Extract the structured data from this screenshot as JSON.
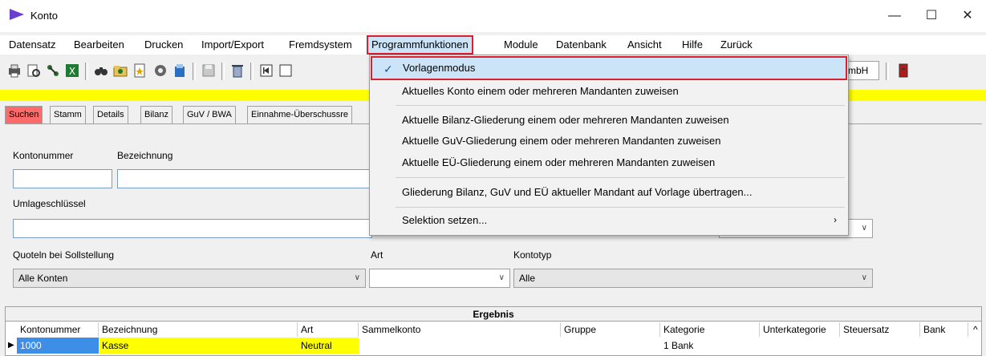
{
  "window": {
    "title": "Konto",
    "minimize": "—",
    "maximize": "☐",
    "close": "✕"
  },
  "menubar": [
    "Datensatz",
    "Bearbeiten",
    "Drucken",
    "Import/Export",
    "Fremdsystem",
    "Programmfunktionen",
    "Module",
    "Datenbank",
    "Ansicht",
    "Hilfe",
    "Zurück"
  ],
  "toolbar": {
    "combo_fragment": "mbH"
  },
  "tabs": [
    "Suchen",
    "Stamm",
    "Details",
    "Bilanz",
    "GuV / BWA",
    "Einnahme-Überschussre"
  ],
  "form": {
    "kontonummer_label": "Kontonummer",
    "bezeichnung_label": "Bezeichnung",
    "umlage_label": "Umlageschlüssel",
    "quoteln_label": "Quoteln bei Sollstellung",
    "quoteln_value": "Alle Konten",
    "art_label": "Art",
    "art_value": "",
    "kontotyp_label": "Kontotyp",
    "kontotyp_value": "Alle"
  },
  "results": {
    "title": "Ergebnis",
    "columns": [
      "Kontonummer",
      "Bezeichnung",
      "Art",
      "Sammelkonto",
      "Gruppe",
      "Kategorie",
      "Unterkategorie",
      "Steuersatz",
      "Bank"
    ],
    "row": {
      "kontonummer": "1000",
      "bezeichnung": "Kasse",
      "art": "Neutral",
      "kategorie": "1 Bank"
    }
  },
  "dropdown": {
    "items": [
      "Vorlagenmodus",
      "Aktuelles Konto einem oder mehreren Mandanten zuweisen",
      "Aktuelle Bilanz-Gliederung einem oder mehreren Mandanten zuweisen",
      "Aktuelle GuV-Gliederung einem oder mehreren Mandanten zuweisen",
      "Aktuelle EÜ-Gliederung einem oder mehreren Mandanten zuweisen",
      "Gliederung Bilanz, GuV und EÜ aktueller Mandant auf Vorlage übertragen...",
      "Selektion setzen..."
    ],
    "checked_item": "Vorlagenmodus"
  }
}
